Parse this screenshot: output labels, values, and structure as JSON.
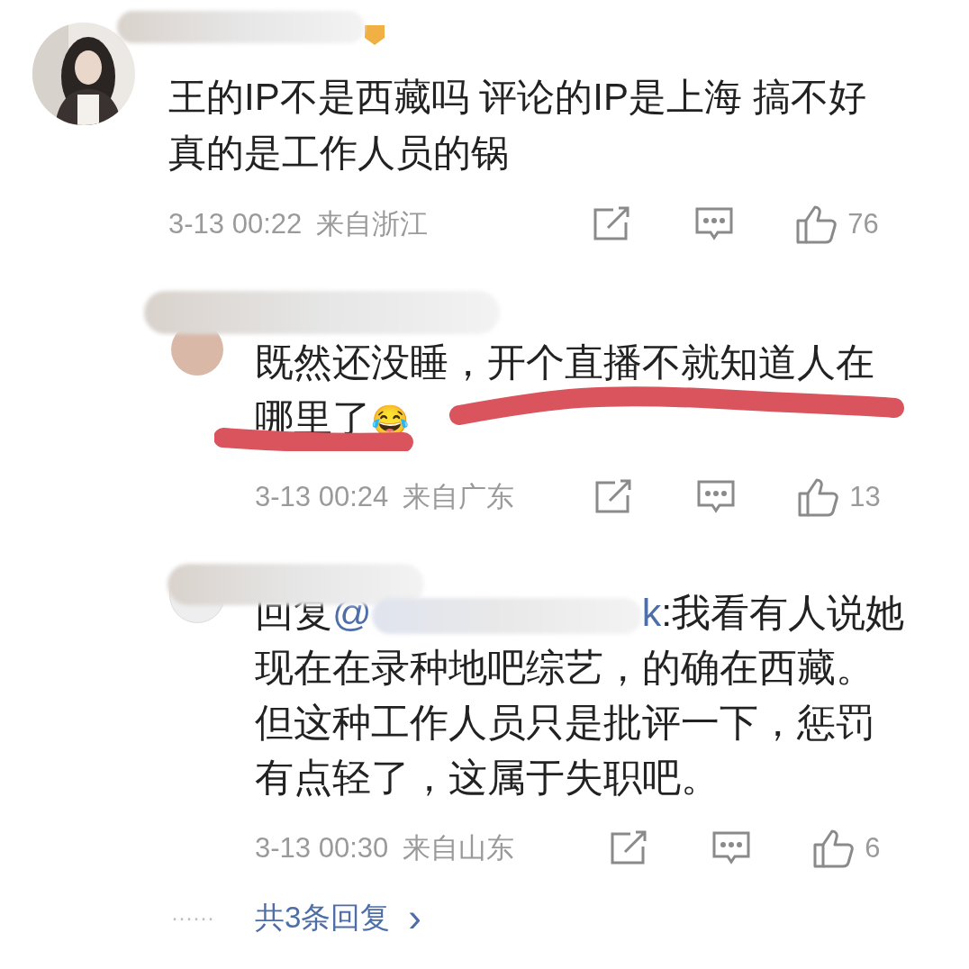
{
  "comment": {
    "text": "王的IP不是西藏吗 评论的IP是上海 搞不好真的是工作人员的锅",
    "time": "3-13 00:22",
    "location": "来自浙江",
    "likes": "76"
  },
  "replies": [
    {
      "text": "既然还没睡，开个直播不就知道人在哪里了",
      "emoji": "😂",
      "annotated": true,
      "time": "3-13 00:24",
      "location": "来自广东",
      "likes": "13"
    },
    {
      "reply_lead": "回复",
      "mention_start": "@",
      "mention_end": "k",
      "text": ":我看有人说她现在在录种地吧综艺，的确在西藏。但这种工作人员只是批评一下，惩罚有点轻了，这属于失职吧。",
      "annotated": false,
      "time": "3-13 00:30",
      "location": "来自山东",
      "likes": "6"
    }
  ],
  "footer": {
    "dots": "······",
    "more_replies": "共3条回复",
    "chevron": "›"
  }
}
